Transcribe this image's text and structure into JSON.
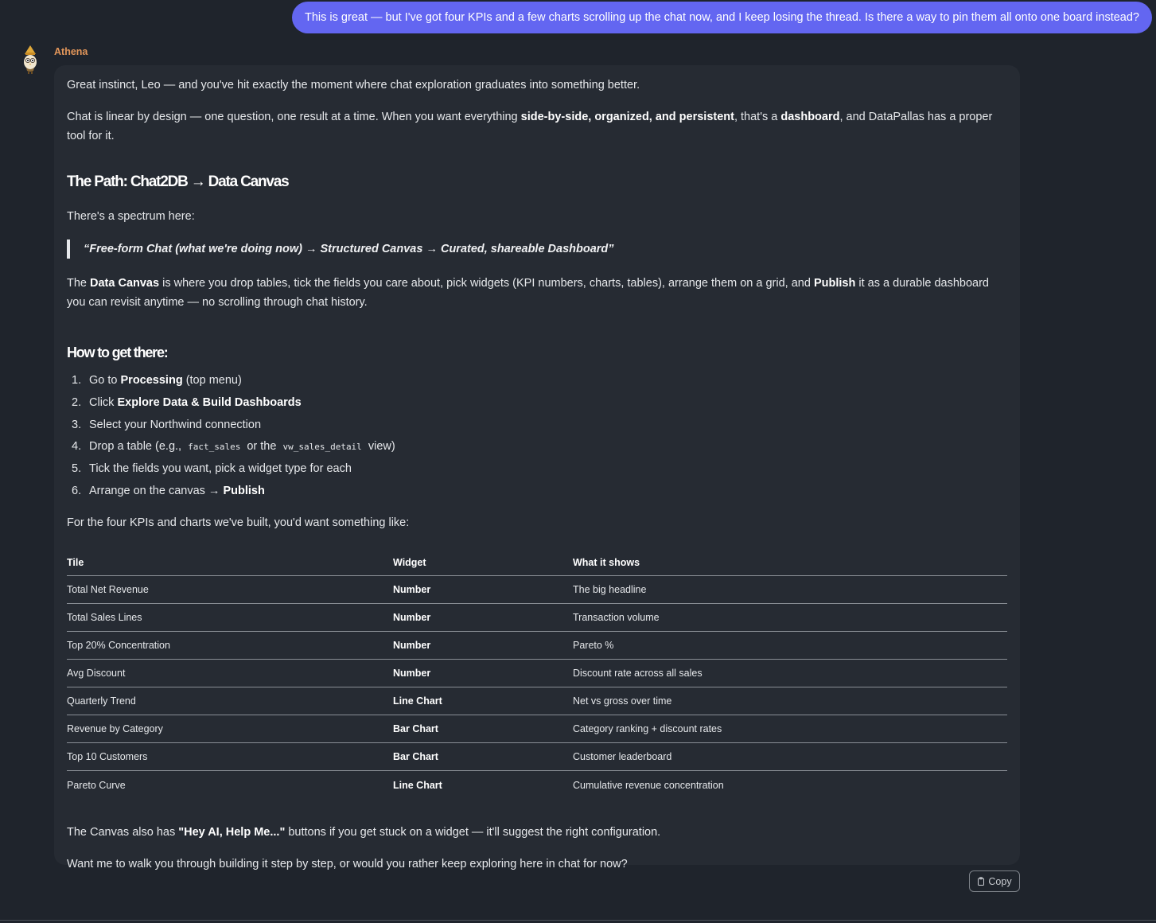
{
  "user_message": "This is great — but I've got four KPIs and a few charts scrolling up the chat now, and I keep losing the thread. Is there a way to pin them all onto one board instead?",
  "assistant": {
    "name": "Athena",
    "intro": "Great instinct, Leo — and you've hit exactly the moment where chat exploration graduates into something better.",
    "chat_p": {
      "a": "Chat is linear by design — one question, one result at a time. When you want everything ",
      "b": "side-by-side, organized, and persistent",
      "c": ", that's a ",
      "d": "dashboard",
      "e": ", and DataPallas has a proper tool for it."
    },
    "heading_path": "The Path: Chat2DB → Data Canvas",
    "spectrum": "There's a spectrum here:",
    "quote": "“Free-form Chat (what we're doing now) → Structured Canvas → Curated, shareable Dashboard”",
    "canvas_p": {
      "a": "The ",
      "b": "Data Canvas",
      "c": " is where you drop tables, tick the fields you care about, pick widgets (KPI numbers, charts, tables), arrange them on a grid, and ",
      "d": "Publish",
      "e": " it as a durable dashboard you can revisit anytime — no scrolling through chat history."
    },
    "heading_how": "How to get there:",
    "steps": {
      "s1": {
        "num": "1.",
        "a": "Go to ",
        "b": "Processing",
        "c": " (top menu)"
      },
      "s2": {
        "num": "2.",
        "a": "Click ",
        "b": "Explore Data & Build Dashboards"
      },
      "s3": {
        "num": "3.",
        "a": "Select your Northwind connection"
      },
      "s4": {
        "num": "4.",
        "a": "Drop a table (e.g., ",
        "code1": "fact_sales",
        "mid": " or the ",
        "code2": "vw_sales_detail",
        "c": " view)"
      },
      "s5": {
        "num": "5.",
        "a": "Tick the fields you want, pick a widget type for each"
      },
      "s6": {
        "num": "6.",
        "a": "Arrange on the canvas → ",
        "b": "Publish"
      }
    },
    "four_p": "For the four KPIs and charts we've built, you'd want something like:",
    "table": {
      "headers": {
        "tile": "Tile",
        "widget": "Widget",
        "shows": "What it shows"
      },
      "rows": [
        {
          "tile": "Total Net Revenue",
          "widget": "Number",
          "shows": "The big headline"
        },
        {
          "tile": "Total Sales Lines",
          "widget": "Number",
          "shows": "Transaction volume"
        },
        {
          "tile": "Top 20% Concentration",
          "widget": "Number",
          "shows": "Pareto %"
        },
        {
          "tile": "Avg Discount",
          "widget": "Number",
          "shows": "Discount rate across all sales"
        },
        {
          "tile": "Quarterly Trend",
          "widget": "Line Chart",
          "shows": "Net vs gross over time"
        },
        {
          "tile": "Revenue by Category",
          "widget": "Bar Chart",
          "shows": "Category ranking + discount rates"
        },
        {
          "tile": "Top 10 Customers",
          "widget": "Bar Chart",
          "shows": "Customer leaderboard"
        },
        {
          "tile": "Pareto Curve",
          "widget": "Line Chart",
          "shows": "Cumulative revenue concentration"
        }
      ]
    },
    "hey_p": {
      "a": "The Canvas also has ",
      "b": "\"Hey AI, Help Me...\"",
      "c": " buttons if you get stuck on a widget — it'll suggest the right configuration."
    },
    "want_p": "Want me to walk you through building it step by step, or would you rather keep exploring here in chat for now?"
  },
  "copy_button": {
    "label": "Copy",
    "icon": "clipboard-icon"
  },
  "colors": {
    "background": "#1f242c",
    "bubble": "#262b33",
    "user_bubble": "#6366f1",
    "assistant_name": "#e2965a"
  }
}
